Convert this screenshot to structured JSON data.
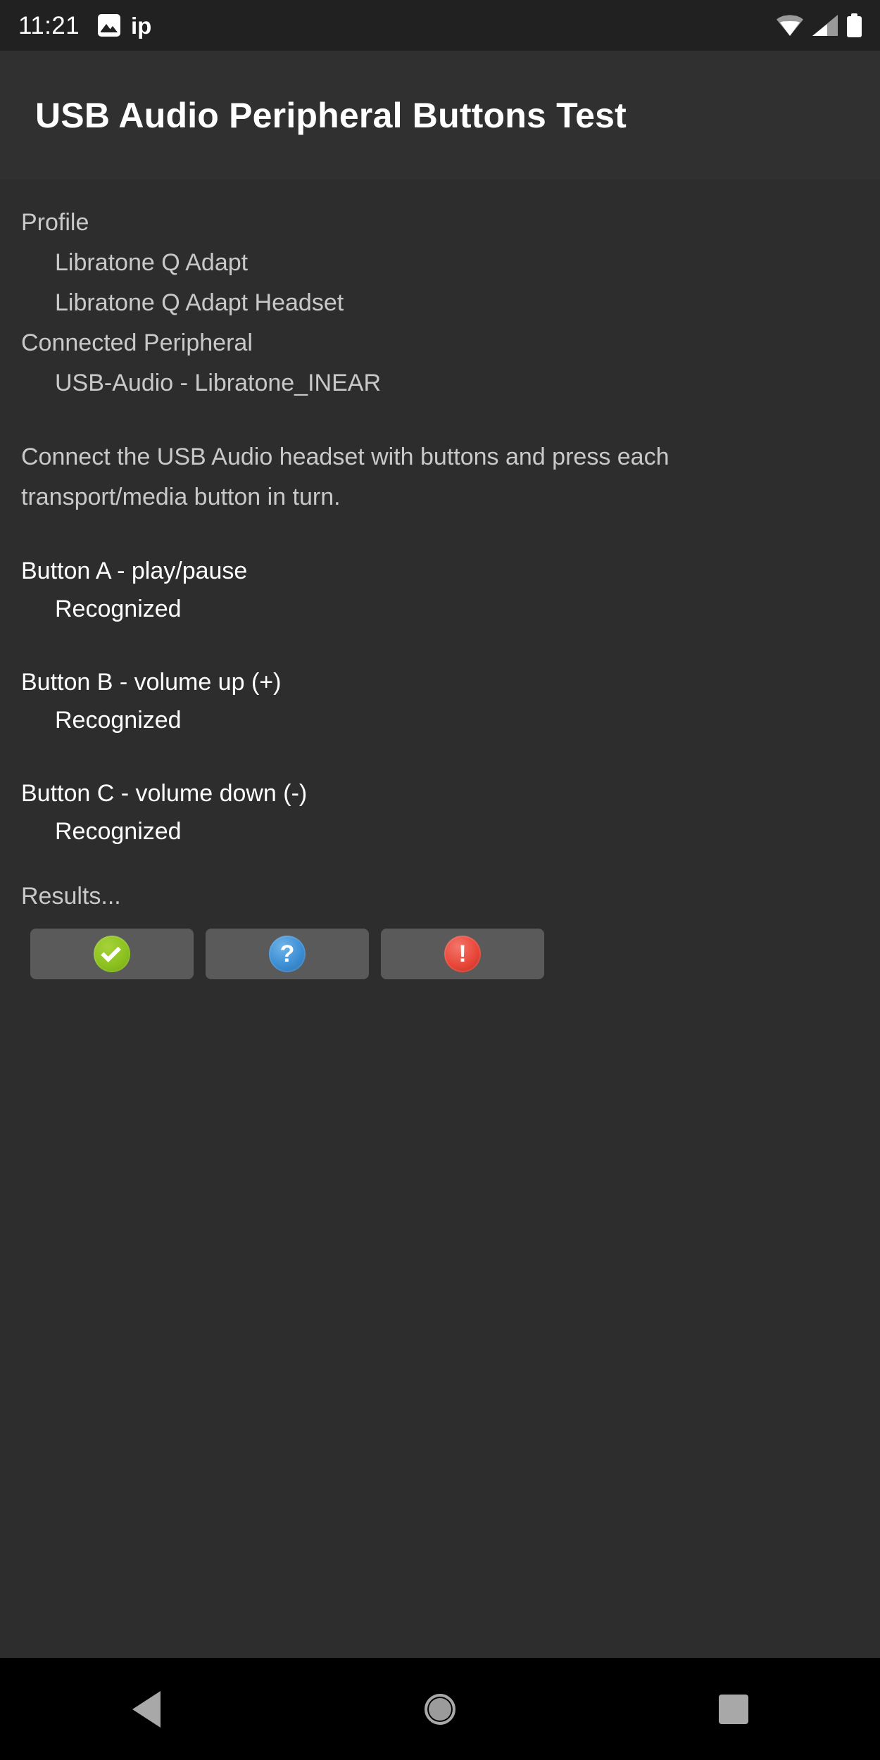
{
  "status_bar": {
    "clock": "11:21",
    "label": "ip",
    "icons": [
      "gallery-icon",
      "wifi-icon",
      "cellular-signal-icon",
      "battery-icon"
    ]
  },
  "header": {
    "title": "USB Audio Peripheral Buttons Test"
  },
  "info": {
    "profile_label": "Profile",
    "profile_values": [
      "Libratone Q Adapt",
      "Libratone Q Adapt Headset"
    ],
    "peripheral_label": "Connected Peripheral",
    "peripheral_values": [
      "USB-Audio - Libratone_INEAR"
    ]
  },
  "instructions": "Connect the USB Audio headset with buttons and press each transport/media button in turn.",
  "button_tests": [
    {
      "name": "Button A - play/pause",
      "status": "Recognized"
    },
    {
      "name": "Button B - volume up (+)",
      "status": "Recognized"
    },
    {
      "name": "Button C - volume down (-)",
      "status": "Recognized"
    }
  ],
  "results": {
    "label": "Results...",
    "buttons": [
      {
        "icon": "pass-check-icon",
        "glyph": "",
        "color": "#8cc220"
      },
      {
        "icon": "info-question-icon",
        "glyph": "?",
        "color": "#3d8ed4"
      },
      {
        "icon": "fail-exclaim-icon",
        "glyph": "!",
        "color": "#e8483a"
      }
    ]
  },
  "nav_bar": {
    "back": "back-icon",
    "home": "home-icon",
    "recents": "recents-icon"
  },
  "colors": {
    "background": "#2d2d2d",
    "status_bar": "#212121",
    "title_bar": "#303030",
    "button_bg": "#5a5a5a",
    "nav_bg": "#000000",
    "text_primary": "#ffffff",
    "text_secondary": "#c9c9c9"
  }
}
